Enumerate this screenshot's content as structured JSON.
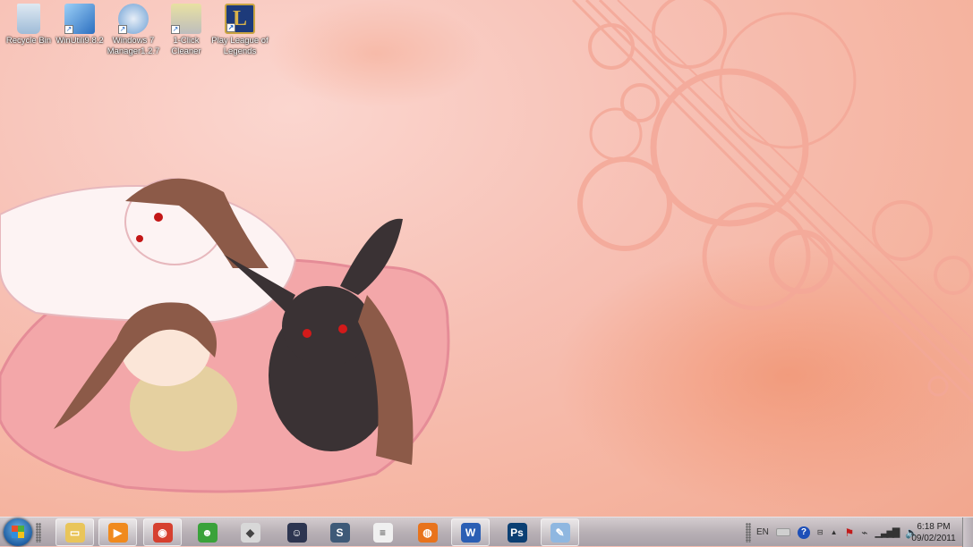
{
  "desktop": {
    "icons": [
      {
        "label": "Recycle Bin",
        "shortcut": false,
        "color": "#a9c7e3"
      },
      {
        "label": "WinUtilities9.8.2",
        "display": "WinUtili9.8.2",
        "shortcut": true,
        "color": "#3f8ed8"
      },
      {
        "label": "Windows 7 Manager1.2.7",
        "shortcut": true,
        "color": "#7ab0e0"
      },
      {
        "label": "1-Click Cleaner",
        "shortcut": true,
        "color": "#c9c36a"
      },
      {
        "label": "Play League of Legends",
        "shortcut": true,
        "color": "#1d3a7a"
      }
    ]
  },
  "taskbar": {
    "items": [
      {
        "name": "windows-explorer",
        "glyph": "▭",
        "color": "#e9c55a"
      },
      {
        "name": "windows-media-player",
        "glyph": "▶",
        "color": "#f08a1e"
      },
      {
        "name": "google-chrome",
        "glyph": "◉",
        "color": "#d6402f"
      },
      {
        "name": "windows-live-messenger",
        "glyph": "☻",
        "color": "#3aa23a"
      },
      {
        "name": "wolf-app",
        "glyph": "◆",
        "color": "#d8d8d8"
      },
      {
        "name": "anime-app",
        "glyph": "☺",
        "color": "#2d3550"
      },
      {
        "name": "starcraft-2",
        "glyph": "S",
        "color": "#3e5a78"
      },
      {
        "name": "document",
        "glyph": "≡",
        "color": "#f0f0f0"
      },
      {
        "name": "firefox",
        "glyph": "◍",
        "color": "#e8731c"
      },
      {
        "name": "microsoft-word",
        "glyph": "W",
        "color": "#2b5fb4"
      },
      {
        "name": "photoshop",
        "glyph": "Ps",
        "color": "#0b3f73"
      },
      {
        "name": "paint",
        "glyph": "✎",
        "color": "#8fb7e0"
      }
    ]
  },
  "tray": {
    "language": "EN",
    "time": "6:18 PM",
    "date": "09/02/2011"
  }
}
